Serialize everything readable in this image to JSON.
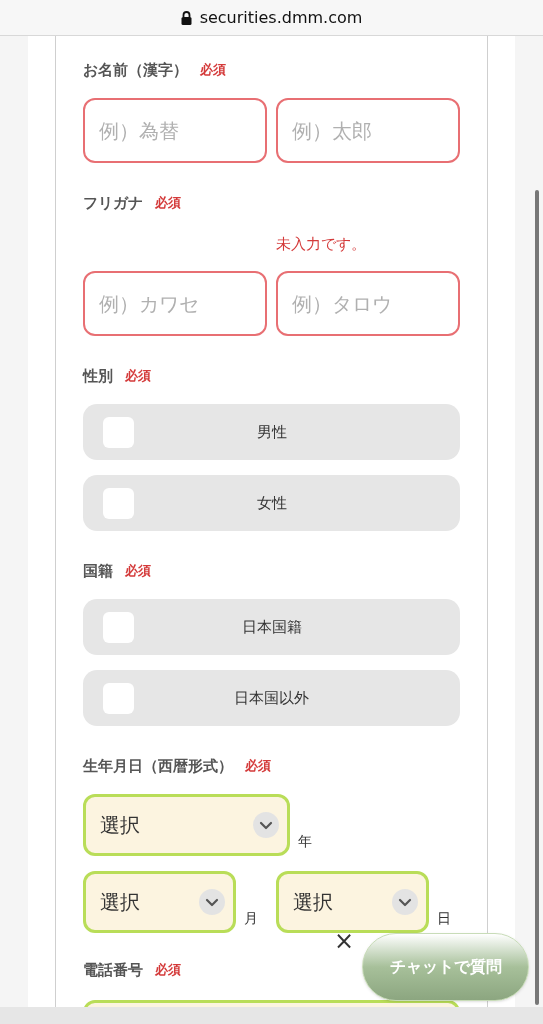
{
  "browser": {
    "url": "securities.dmm.com"
  },
  "sections": [
    {
      "kind": "text_pair",
      "label": "お名前（漢字）",
      "required": "必須",
      "fields": [
        {
          "placeholder": "例）為替",
          "invalid": true
        },
        {
          "placeholder": "例）太郎",
          "invalid": true
        }
      ]
    },
    {
      "kind": "text_pair",
      "label": "フリガナ",
      "required": "必須",
      "error": "未入力です。",
      "fields": [
        {
          "placeholder": "例）カワセ",
          "invalid": true
        },
        {
          "placeholder": "例）タロウ",
          "invalid": true
        }
      ]
    },
    {
      "kind": "checkbox_list",
      "label": "性別",
      "required": "必須",
      "options": [
        {
          "label": "男性",
          "checked": false
        },
        {
          "label": "女性",
          "checked": false
        }
      ]
    },
    {
      "kind": "checkbox_list",
      "label": "国籍",
      "required": "必須",
      "options": [
        {
          "label": "日本国籍",
          "checked": false
        },
        {
          "label": "日本国以外",
          "checked": false
        }
      ]
    },
    {
      "kind": "date_selects",
      "label": "生年月日（西暦形式）",
      "required": "必須",
      "selects": [
        {
          "value": "選択",
          "unit": "年"
        },
        {
          "value": "選択",
          "unit": "月"
        },
        {
          "value": "選択",
          "unit": "日"
        }
      ]
    },
    {
      "kind": "phone",
      "label": "電話番号",
      "required": "必須"
    }
  ],
  "chat": {
    "close": "×",
    "button": "チャットで質問"
  }
}
